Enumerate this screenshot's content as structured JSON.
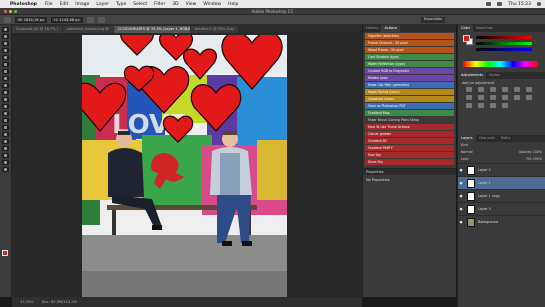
{
  "menubar": {
    "app": "Photoshop",
    "items": [
      "File",
      "Edit",
      "Image",
      "Layer",
      "Type",
      "Select",
      "Filter",
      "3D",
      "View",
      "Window",
      "Help"
    ],
    "clock": "Thu 15:23"
  },
  "window": {
    "title": "Adobe Photoshop CC"
  },
  "options": {
    "field1": "W: 1634,16 px",
    "field2": "H: 1143,68 px",
    "workspace": "Essentials"
  },
  "tabs": [
    {
      "label": "Snapchat_62 @ 16,7% (",
      "active": false
    },
    {
      "label": "valentine_hearts.png @",
      "active": false
    },
    {
      "label": "CC2015HEARTS @ 33,3% (Layer 1, RGB/8*)",
      "active": true
    },
    {
      "label": "Untitled-1 @ 33% (Lay",
      "active": false
    }
  ],
  "status": {
    "zoom": "33,33%",
    "doc": "Doc: 69,9M/110,5M"
  },
  "actions_panel": {
    "tabs": [
      "History",
      "Actions"
    ],
    "items": [
      {
        "label": "Vignette (selection)",
        "color": "#b4541c"
      },
      {
        "label": "Frame Channel - 50 pixel",
        "color": "#b4541c"
      },
      {
        "label": "Wood Frame - 50 pixel",
        "color": "#b4541c"
      },
      {
        "label": "Cast Shadow (type)",
        "color": "#3c8a46"
      },
      {
        "label": "Water Reflection (type)",
        "color": "#3c8a46"
      },
      {
        "label": "Custom RGB to Grayscale",
        "color": "#6c45a8"
      },
      {
        "label": "Molten Lead",
        "color": "#6c45a8"
      },
      {
        "label": "Make Clip Path (selection)",
        "color": "#3c6cb4"
      },
      {
        "label": "Sepia Toning (layer)",
        "color": "#b4891c"
      },
      {
        "label": "Quadrant Colors",
        "color": "#b4891c"
      },
      {
        "label": "Save as Photoshop PDF",
        "color": "#3c6cb4"
      },
      {
        "label": "Gradient Map",
        "color": "#3c8a46"
      },
      {
        "label": "Mixer Brush Cloning Paint Setup",
        "color": ""
      },
      {
        "label": "How To Use These Actions",
        "color": "#a62a2a"
      },
      {
        "label": "Corner gadder",
        "color": "#a62a2a"
      },
      {
        "label": "Gradient RC",
        "color": "#a62a2a"
      },
      {
        "label": "Gradient PARTY",
        "color": "#a62a2a"
      },
      {
        "label": "Hue Stp",
        "color": "#a62a2a"
      },
      {
        "label": "Dune Stp",
        "color": "#a62a2a"
      }
    ]
  },
  "properties": {
    "title": "Properties",
    "empty": "No Properties"
  },
  "color_panel": {
    "tabs": [
      "Color",
      "Swatches"
    ],
    "fg": "#d52020",
    "bg": "#ffffff"
  },
  "adjustments": {
    "tabs": [
      "Adjustments",
      "Styles"
    ],
    "hint": "Add an adjustment"
  },
  "layers_panel": {
    "tabs": [
      "Layers",
      "Channels",
      "Paths"
    ],
    "kind": "Kind",
    "blend": "Normal",
    "opacity_label": "Opacity:",
    "opacity": "100%",
    "lock_label": "Lock:",
    "fill_label": "Fill:",
    "fill": "100%",
    "layers": [
      {
        "name": "Layer 2",
        "selected": false
      },
      {
        "name": "Layer 1",
        "selected": true
      },
      {
        "name": "Layer 1 copy",
        "selected": false
      },
      {
        "name": "Layer 3",
        "selected": false
      },
      {
        "name": "Background",
        "selected": false
      }
    ]
  }
}
